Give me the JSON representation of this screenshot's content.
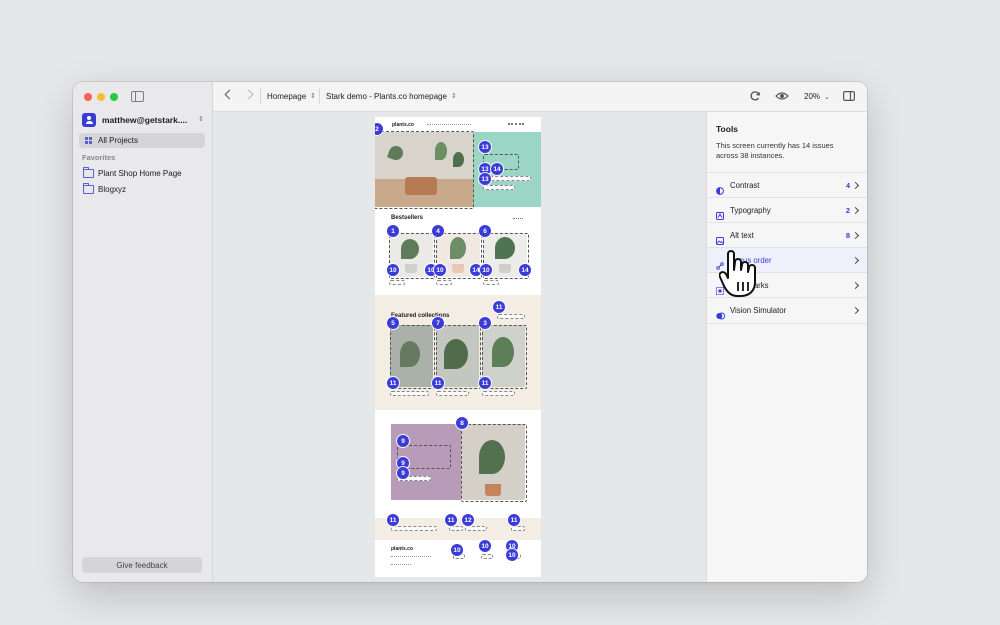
{
  "sidebar": {
    "account_name": "matthew@getstark....",
    "all_projects": "All Projects",
    "favorites_heading": "Favorites",
    "favorites": [
      {
        "label": "Plant Shop Home Page",
        "icon": "folder-icon"
      },
      {
        "label": "Blogxyz",
        "icon": "folder-icon"
      }
    ],
    "feedback_button": "Give feedback"
  },
  "toolbar": {
    "page_select": "Homepage",
    "file_select": "Stark demo - Plants.co homepage",
    "zoom": "20%"
  },
  "preview": {
    "logo": "plants.co",
    "bestsellers_heading": "Bestsellers",
    "featured_heading": "Featured collections",
    "footer_logo": "plants.co",
    "badges": {
      "b2": "2",
      "b13a": "13",
      "b13b": "13",
      "b14a": "14",
      "b13c": "13",
      "b1": "1",
      "b4": "4",
      "b6": "6",
      "b10a": "10",
      "b10b": "10",
      "b10c": "10",
      "b10d": "10",
      "b14b": "14",
      "b14c": "14",
      "b11top": "11",
      "b5": "5",
      "b7": "7",
      "b3": "3",
      "b11a": "11",
      "b11b": "11",
      "b11c": "11",
      "b8": "8",
      "b9a": "9",
      "b9b": "9",
      "b9c": "9",
      "b11d": "11",
      "b11e": "11",
      "b12": "12",
      "b11f": "11",
      "b10e": "10",
      "b10f": "10",
      "b10g": "10",
      "b10h": "10"
    }
  },
  "tools_panel": {
    "title": "Tools",
    "description": "This screen currently has 14 issues across 38 instances.",
    "items": [
      {
        "label": "Contrast",
        "count": "4",
        "icon": "contrast-icon"
      },
      {
        "label": "Typography",
        "count": "2",
        "icon": "typography-icon"
      },
      {
        "label": "Alt text",
        "count": "8",
        "icon": "alt-text-icon"
      },
      {
        "label": "Focus order",
        "count": "",
        "icon": "focus-order-icon"
      },
      {
        "label": "Landmarks",
        "count": "",
        "icon": "landmarks-icon"
      },
      {
        "label": "Vision Simulator",
        "count": "",
        "icon": "vision-simulator-icon"
      }
    ]
  },
  "colors": {
    "accent": "#3b3bd8",
    "hero_mint": "#9bd6c4",
    "featured_bg": "#f3ede4",
    "promo_purple": "#b89bb8"
  }
}
